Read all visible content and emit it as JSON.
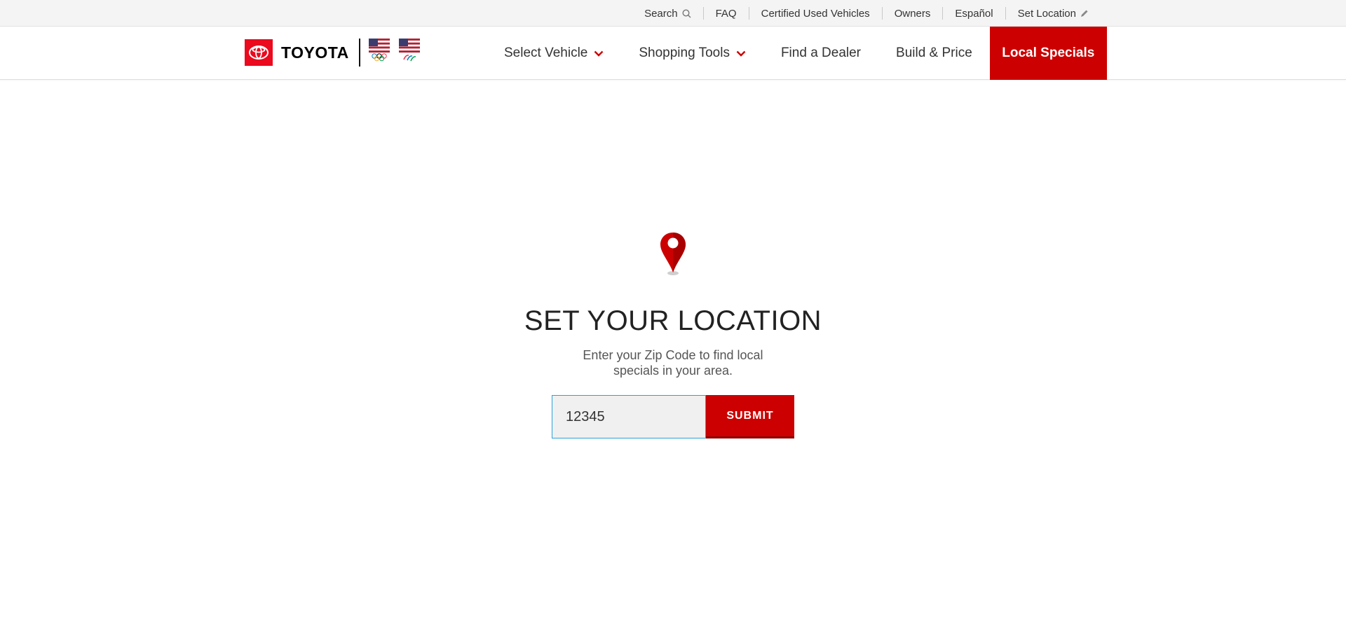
{
  "utility_nav": {
    "items": [
      {
        "label": "Search",
        "icon": "search-icon"
      },
      {
        "label": "FAQ"
      },
      {
        "label": "Certified Used Vehicles"
      },
      {
        "label": "Owners"
      },
      {
        "label": "Español"
      },
      {
        "label": "Set Location",
        "icon": "pencil-icon"
      }
    ]
  },
  "header": {
    "brand": "TOYOTA",
    "brand_color": "#eb0a1e",
    "nav": [
      {
        "label": "Select Vehicle",
        "has_dropdown": true
      },
      {
        "label": "Shopping Tools",
        "has_dropdown": true
      },
      {
        "label": "Find a Dealer"
      },
      {
        "label": "Build & Price"
      },
      {
        "label": "Local Specials",
        "active": true
      }
    ],
    "active_color": "#cc0000"
  },
  "location": {
    "title": "SET YOUR LOCATION",
    "description": "Enter your Zip Code to find local specials in your area.",
    "zip_value": "12345",
    "submit_label": "SUBMIT"
  }
}
